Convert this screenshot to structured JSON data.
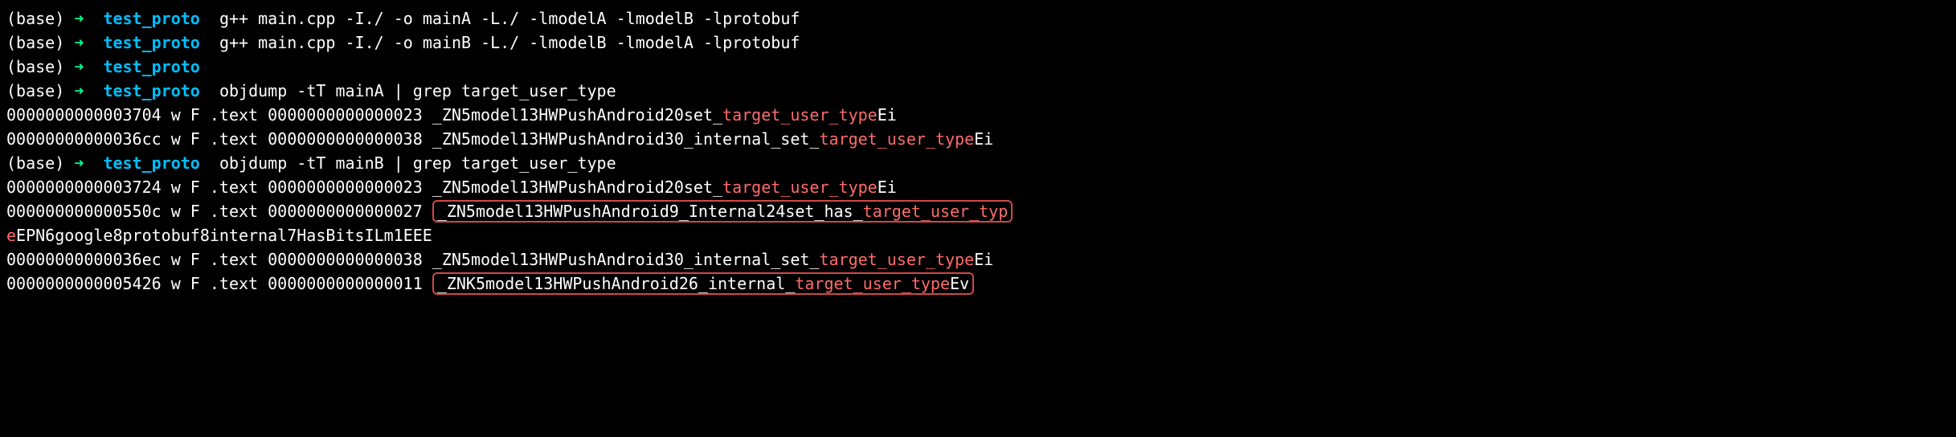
{
  "lines": [
    {
      "prompt_base": "(base)",
      "prompt_arrow": "➜",
      "prompt_dir": "test_proto",
      "cmd": "g++ main.cpp -I./ -o mainA -L./  -lmodelA -lmodelB -lprotobuf"
    },
    {
      "prompt_base": "(base)",
      "prompt_arrow": "➜",
      "prompt_dir": "test_proto",
      "cmd": "g++ main.cpp -I./ -o mainB -L./  -lmodelB -lmodelA -lprotobuf"
    },
    {
      "prompt_base": "(base)",
      "prompt_arrow": "➜",
      "prompt_dir": "test_proto",
      "cmd": ""
    },
    {
      "prompt_base": "(base)",
      "prompt_arrow": "➜",
      "prompt_dir": "test_proto",
      "cmd": "objdump -tT  mainA | grep target_user_type"
    }
  ],
  "out1": {
    "l1_pre": "0000000000003704  w    F .text  0000000000000023              _ZN5model13HWPushAndroid20set_",
    "l1_hl": "target_user_type",
    "l1_post": "Ei",
    "l2_pre": "00000000000036cc  w    F .text  0000000000000038              _ZN5model13HWPushAndroid30_internal_set_",
    "l2_hl": "target_user_type",
    "l2_post": "Ei"
  },
  "prompt2": {
    "base": "(base)",
    "arrow": "➜",
    "dir": "test_proto",
    "cmd": "objdump -tT  mainB | grep target_user_type"
  },
  "out2": {
    "l1_pre": "0000000000003724  w    F .text  0000000000000023              _ZN5model13HWPushAndroid20set_",
    "l1_hl": "target_user_type",
    "l1_post": "Ei",
    "l2_pre": "000000000000550c  w    F .text  0000000000000027              ",
    "l2_boxed_pre": "_ZN5model13HWPushAndroid9_Internal24set_has_",
    "l2_boxed_hl": "target_user_typ",
    "l3_hl": "e",
    "l3_post": "EPN6google8protobuf8internal7HasBitsILm1EEE",
    "l4_pre": "00000000000036ec  w    F .text  0000000000000038              _ZN5model13HWPushAndroid30_internal_set_",
    "l4_hl": "target_user_type",
    "l4_post": "Ei",
    "l5_pre": "0000000000005426  w    F .text  0000000000000011              ",
    "l5_boxed_pre": "_ZNK5model13HWPushAndroid26_internal_",
    "l5_boxed_hl": "target_user_type",
    "l5_boxed_post": "Ev"
  }
}
